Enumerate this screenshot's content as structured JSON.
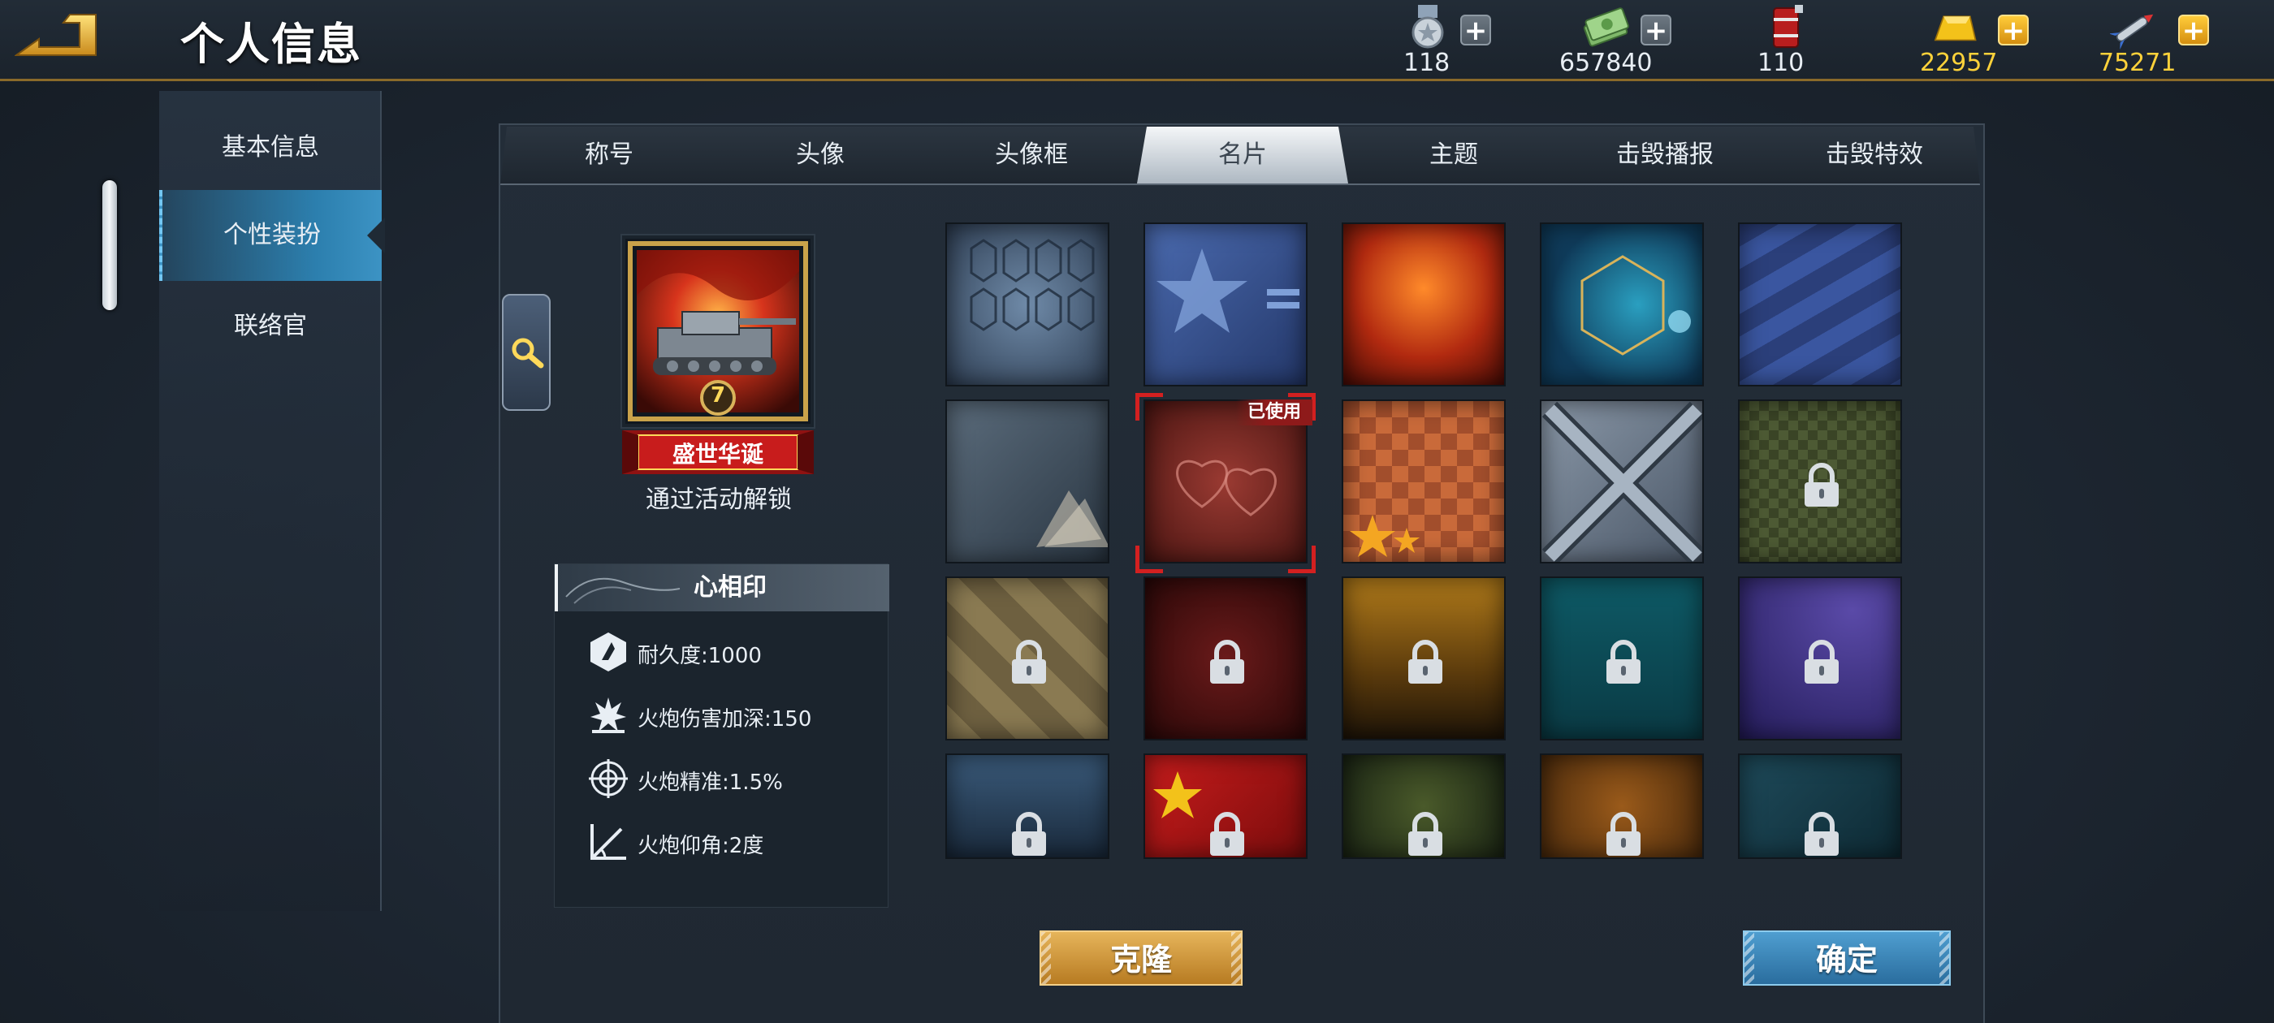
{
  "header": {
    "title": "个人信息",
    "back_icon": "back-arrow-icon"
  },
  "resources": [
    {
      "name": "medal",
      "icon": "medal-icon",
      "value": "118",
      "plus": "gray"
    },
    {
      "name": "cash",
      "icon": "cash-icon",
      "value": "657840",
      "plus": "gray"
    },
    {
      "name": "fuel",
      "icon": "fuel-barrel-icon",
      "value": "110",
      "plus": "none"
    },
    {
      "name": "gold",
      "icon": "gold-bar-icon",
      "value": "22957",
      "plus": "gold"
    },
    {
      "name": "missile",
      "icon": "missile-icon",
      "value": "75271",
      "plus": "gold"
    }
  ],
  "sidebar": {
    "items": [
      {
        "label": "基本信息",
        "active": false
      },
      {
        "label": "个性装扮",
        "active": true
      },
      {
        "label": "联络官",
        "active": false
      }
    ]
  },
  "tabs": [
    {
      "label": "称号",
      "active": false
    },
    {
      "label": "头像",
      "active": false
    },
    {
      "label": "头像框",
      "active": false
    },
    {
      "label": "名片",
      "active": true
    },
    {
      "label": "主题",
      "active": false
    },
    {
      "label": "击毁播报",
      "active": false
    },
    {
      "label": "击毁特效",
      "active": false
    }
  ],
  "preview": {
    "badge_number": "7",
    "banner_text": "盛世华诞",
    "unlock_text": "通过活动解锁"
  },
  "stats": {
    "title": "心相印",
    "rows": [
      {
        "icon": "armor-shield-icon",
        "text": "耐久度:1000"
      },
      {
        "icon": "explosion-icon",
        "text": "火炮伤害加深:150"
      },
      {
        "icon": "crosshair-icon",
        "text": "火炮精准:1.5%"
      },
      {
        "icon": "elevation-angle-icon",
        "text": "火炮仰角:2度"
      }
    ]
  },
  "grid": {
    "used_label": "已使用",
    "tiles": [
      {
        "theme": "blue-hex-pattern",
        "locked": false
      },
      {
        "theme": "blue-star",
        "locked": false
      },
      {
        "theme": "fire",
        "locked": false
      },
      {
        "theme": "teal-hexagon-tech",
        "locked": false
      },
      {
        "theme": "blue-diagonal-stripes",
        "locked": false
      },
      {
        "theme": "gray-pages",
        "locked": false
      },
      {
        "theme": "red-hearts",
        "locked": false,
        "used": true
      },
      {
        "theme": "orange-tiles-stars",
        "locked": false
      },
      {
        "theme": "steel-cross",
        "locked": false
      },
      {
        "theme": "digital-camo",
        "locked": true
      },
      {
        "theme": "gold-diamond",
        "locked": true
      },
      {
        "theme": "dark-red",
        "locked": true
      },
      {
        "theme": "golden-sunset",
        "locked": true
      },
      {
        "theme": "teal-ocean",
        "locked": true
      },
      {
        "theme": "purple-night",
        "locked": true
      },
      {
        "theme": "helicopter-silhouette",
        "locked": true
      },
      {
        "theme": "red-star-flag",
        "locked": true
      },
      {
        "theme": "green-floral",
        "locked": true
      },
      {
        "theme": "autumn-leaves",
        "locked": true
      },
      {
        "theme": "teal-snowflake",
        "locked": true
      }
    ]
  },
  "buttons": {
    "clone": "克隆",
    "confirm": "确定"
  },
  "colors": {
    "accent_gold": "#d9a441",
    "accent_blue": "#2c7fae",
    "used_red": "#d32020"
  }
}
